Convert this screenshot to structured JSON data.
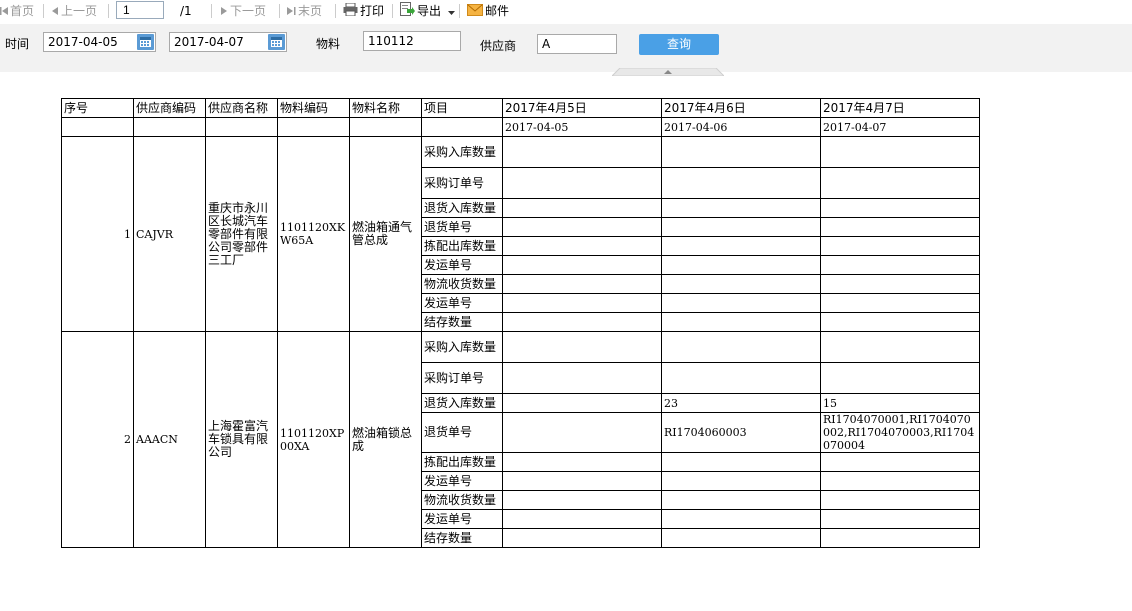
{
  "toolbar": {
    "first": "首页",
    "prev": "上一页",
    "page_value": "1",
    "page_total": "/1",
    "next": "下一页",
    "last": "末页",
    "print": "打印",
    "export": "导出",
    "mail": "邮件"
  },
  "filters": {
    "time_label": "时间",
    "date_from": "2017-04-05",
    "date_to": "2017-04-07",
    "material_label": "物料",
    "material_value": "110112",
    "supplier_label": "供应商",
    "supplier_value": "A",
    "query_button": "查询"
  },
  "colors": {
    "accent": "#4aa0e6",
    "filter_bg": "#f2f2f2",
    "calendar": "#5b9bd5"
  },
  "table": {
    "headers": [
      "序号",
      "供应商编码",
      "供应商名称",
      "物料编码",
      "物料名称",
      "项目",
      "2017年4月5日",
      "2017年4月6日",
      "2017年4月7日"
    ],
    "dates": [
      "2017-04-05",
      "2017-04-06",
      "2017-04-07"
    ],
    "records": [
      {
        "no": "1",
        "supplier_code": "CAJVR",
        "supplier_name": "重庆市永川区长城汽车零部件有限公司零部件三工厂",
        "material_code": "1101120XKW65A",
        "material_name": "燃油箱通气管总成",
        "items": [
          {
            "label": "采购入库数量",
            "values": [
              "",
              "",
              ""
            ]
          },
          {
            "label": "采购订单号",
            "values": [
              "",
              "",
              ""
            ]
          },
          {
            "label": "退货入库数量",
            "values": [
              "",
              "",
              ""
            ]
          },
          {
            "label": "退货单号",
            "values": [
              "",
              "",
              ""
            ]
          },
          {
            "label": "拣配出库数量",
            "values": [
              "",
              "",
              ""
            ]
          },
          {
            "label": "发运单号",
            "values": [
              "",
              "",
              ""
            ]
          },
          {
            "label": "物流收货数量",
            "values": [
              "",
              "",
              ""
            ]
          },
          {
            "label": "发运单号",
            "values": [
              "",
              "",
              ""
            ]
          },
          {
            "label": "结存数量",
            "values": [
              "",
              "",
              ""
            ]
          }
        ]
      },
      {
        "no": "2",
        "supplier_code": "AAACN",
        "supplier_name": "上海霍富汽车锁具有限公司",
        "material_code": "1101120XP00XA",
        "material_name": "燃油箱锁总成",
        "items": [
          {
            "label": "采购入库数量",
            "values": [
              "",
              "",
              ""
            ]
          },
          {
            "label": "采购订单号",
            "values": [
              "",
              "",
              ""
            ]
          },
          {
            "label": "退货入库数量",
            "values": [
              "",
              "23",
              "15"
            ]
          },
          {
            "label": "退货单号",
            "values": [
              "",
              "RI1704060003",
              "RI1704070001,RI1704070002,RI1704070003,RI1704070004"
            ]
          },
          {
            "label": "拣配出库数量",
            "values": [
              "",
              "",
              ""
            ]
          },
          {
            "label": "发运单号",
            "values": [
              "",
              "",
              ""
            ]
          },
          {
            "label": "物流收货数量",
            "values": [
              "",
              "",
              ""
            ]
          },
          {
            "label": "发运单号",
            "values": [
              "",
              "",
              ""
            ]
          },
          {
            "label": "结存数量",
            "values": [
              "",
              "",
              ""
            ]
          }
        ]
      }
    ]
  }
}
